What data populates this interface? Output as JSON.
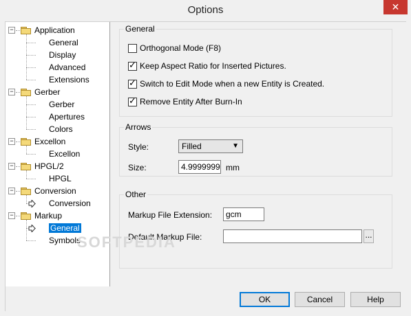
{
  "window": {
    "title": "Options",
    "close_glyph": "✕"
  },
  "tree": {
    "items": [
      {
        "label": "Application",
        "children": [
          "General",
          "Display",
          "Advanced",
          "Extensions"
        ]
      },
      {
        "label": "Gerber",
        "children": [
          "Gerber",
          "Apertures",
          "Colors"
        ]
      },
      {
        "label": "Excellon",
        "children": [
          "Excellon"
        ]
      },
      {
        "label": "HPGL/2",
        "children": [
          "HPGL"
        ]
      },
      {
        "label": "Conversion",
        "children": [
          "Conversion"
        ]
      },
      {
        "label": "Markup",
        "children": [
          "General",
          "Symbols"
        ]
      }
    ],
    "expand_glyph": "−",
    "selected": "Markup/General"
  },
  "general_group": {
    "title": "General",
    "checkboxes": [
      {
        "label": "Orthogonal Mode (F8)",
        "checked": false
      },
      {
        "label": "Keep Aspect Ratio for Inserted Pictures.",
        "checked": true
      },
      {
        "label": "Switch to Edit Mode when a new Entity is Created.",
        "checked": true
      },
      {
        "label": "Remove Entity After Burn-In",
        "checked": true
      }
    ],
    "tick_glyph": "✓"
  },
  "arrows_group": {
    "title": "Arrows",
    "style_label": "Style:",
    "style_value": "Filled",
    "size_label": "Size:",
    "size_value": "4.99999999",
    "size_unit": "mm"
  },
  "other_group": {
    "title": "Other",
    "ext_label": "Markup File Extension:",
    "ext_value": "gcm",
    "default_label": "Default Markup File:",
    "default_value": "",
    "browse_label": "..."
  },
  "buttons": {
    "ok": "OK",
    "cancel": "Cancel",
    "help": "Help"
  },
  "watermark": "SOFTPEDIA"
}
